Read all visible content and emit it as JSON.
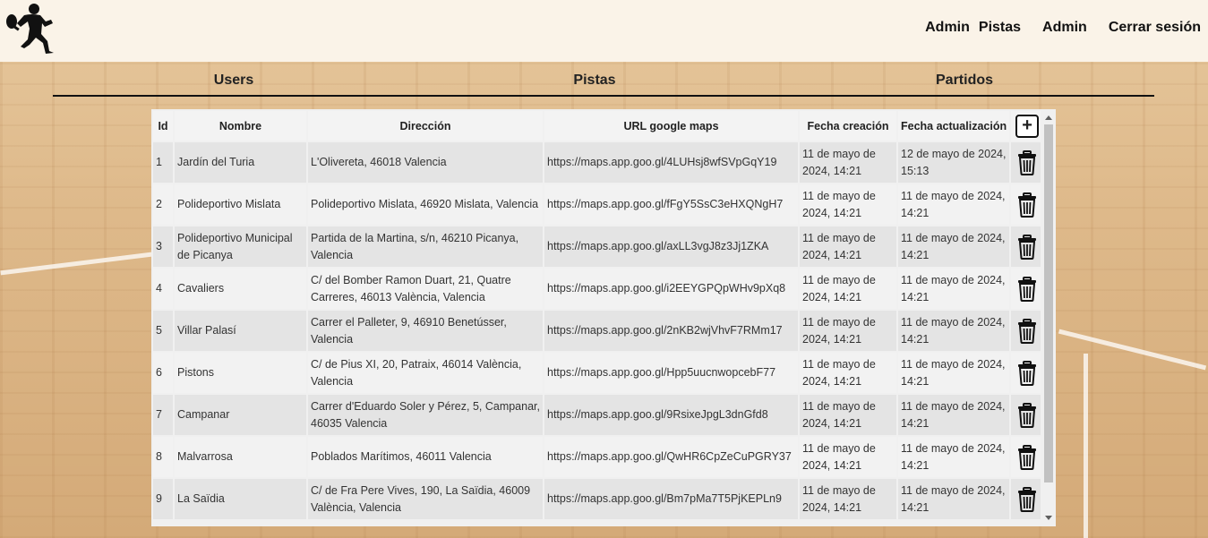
{
  "nav": {
    "items": [
      "Admin",
      "Pistas",
      "Admin",
      "Cerrar sesión"
    ]
  },
  "tabs": [
    "Users",
    "Pistas",
    "Partidos"
  ],
  "table": {
    "headers": {
      "id": "Id",
      "nombre": "Nombre",
      "direccion": "Dirección",
      "url": "URL google maps",
      "creacion": "Fecha creación",
      "actualizacion": "Fecha actualización",
      "add": "+"
    },
    "rows": [
      {
        "id": "1",
        "nombre": "Jardín del Turia",
        "direccion": "L'Olivereta, 46018 Valencia",
        "url": "https://maps.app.goo.gl/4LUHsj8wfSVpGqY19",
        "creacion": "11 de mayo de 2024, 14:21",
        "actualizacion": "12 de mayo de 2024, 15:13"
      },
      {
        "id": "2",
        "nombre": "Polideportivo Mislata",
        "direccion": "Polideportivo Mislata, 46920 Mislata, Valencia",
        "url": "https://maps.app.goo.gl/fFgY5SsC3eHXQNgH7",
        "creacion": "11 de mayo de 2024, 14:21",
        "actualizacion": "11 de mayo de 2024, 14:21"
      },
      {
        "id": "3",
        "nombre": "Polideportivo Municipal de Picanya",
        "direccion": "Partida de la Martina, s/n, 46210 Picanya, Valencia",
        "url": "https://maps.app.goo.gl/axLL3vgJ8z3Jj1ZKA",
        "creacion": "11 de mayo de 2024, 14:21",
        "actualizacion": "11 de mayo de 2024, 14:21"
      },
      {
        "id": "4",
        "nombre": "Cavaliers",
        "direccion": "C/ del Bomber Ramon Duart, 21, Quatre Carreres, 46013 València, Valencia",
        "url": "https://maps.app.goo.gl/i2EEYGPQpWHv9pXq8",
        "creacion": "11 de mayo de 2024, 14:21",
        "actualizacion": "11 de mayo de 2024, 14:21"
      },
      {
        "id": "5",
        "nombre": "Villar Palasí",
        "direccion": "Carrer el Palleter, 9, 46910 Benetússer, Valencia",
        "url": "https://maps.app.goo.gl/2nKB2wjVhvF7RMm17",
        "creacion": "11 de mayo de 2024, 14:21",
        "actualizacion": "11 de mayo de 2024, 14:21"
      },
      {
        "id": "6",
        "nombre": "Pistons",
        "direccion": "C/ de Pius XI, 20, Patraix, 46014 València, Valencia",
        "url": "https://maps.app.goo.gl/Hpp5uucnwopcebF77",
        "creacion": "11 de mayo de 2024, 14:21",
        "actualizacion": "11 de mayo de 2024, 14:21"
      },
      {
        "id": "7",
        "nombre": "Campanar",
        "direccion": "Carrer d'Eduardo Soler y Pérez, 5, Campanar, 46035 Valencia",
        "url": "https://maps.app.goo.gl/9RsixeJpgL3dnGfd8",
        "creacion": "11 de mayo de 2024, 14:21",
        "actualizacion": "11 de mayo de 2024, 14:21"
      },
      {
        "id": "8",
        "nombre": "Malvarrosa",
        "direccion": "Poblados Marítimos, 46011 Valencia",
        "url": "https://maps.app.goo.gl/QwHR6CpZeCuPGRY37",
        "creacion": "11 de mayo de 2024, 14:21",
        "actualizacion": "11 de mayo de 2024, 14:21"
      },
      {
        "id": "9",
        "nombre": "La Saïdia",
        "direccion": "C/ de Fra Pere Vives, 190, La Saïdia, 46009 València, Valencia",
        "url": "https://maps.app.goo.gl/Bm7pMa7T5PjKEPLn9",
        "creacion": "11 de mayo de 2024, 14:21",
        "actualizacion": "11 de mayo de 2024, 14:21"
      }
    ]
  }
}
